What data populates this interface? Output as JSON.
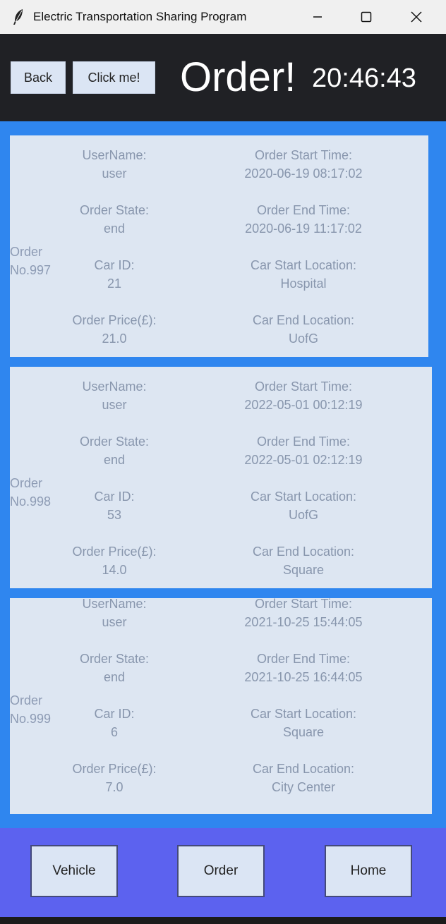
{
  "window": {
    "title": "Electric Transportation Sharing Program"
  },
  "header": {
    "back_label": "Back",
    "click_label": "Click me!",
    "title": "Order!",
    "clock": "20:46:43"
  },
  "labels": {
    "username": "UserName:",
    "order_state": "Order State:",
    "car_id": "Car ID:",
    "order_price": "Order Price(£):",
    "start_time": "Order Start Time:",
    "end_time": "Order End Time:",
    "start_location": "Car Start Location:",
    "end_location": "Car End Location:"
  },
  "orders": [
    {
      "order_word": "Order",
      "order_no": "No.997",
      "username": "user",
      "state": "end",
      "car_id": "21",
      "price": "21.0",
      "start_time": "2020-06-19 08:17:02",
      "end_time": "2020-06-19 11:17:02",
      "start_location": "Hospital",
      "end_location": "UofG"
    },
    {
      "order_word": "Order",
      "order_no": "No.998",
      "username": "user",
      "state": "end",
      "car_id": "53",
      "price": "14.0",
      "start_time": "2022-05-01 00:12:19",
      "end_time": "2022-05-01 02:12:19",
      "start_location": "UofG",
      "end_location": "Square"
    },
    {
      "order_word": "Order",
      "order_no": "No.999",
      "username": "user",
      "state": "end",
      "car_id": "6",
      "price": "7.0",
      "start_time": "2021-10-25 15:44:05",
      "end_time": "2021-10-25 16:44:05",
      "start_location": "Square",
      "end_location": "City Center"
    }
  ],
  "nav": {
    "vehicle": "Vehicle",
    "order": "Order",
    "home": "Home"
  },
  "colors": {
    "header_bg": "#202125",
    "content_bg": "#2f86ef",
    "card_bg": "#dde6f2",
    "nav_bg": "#5c62ef",
    "label_text": "#8896ad"
  }
}
